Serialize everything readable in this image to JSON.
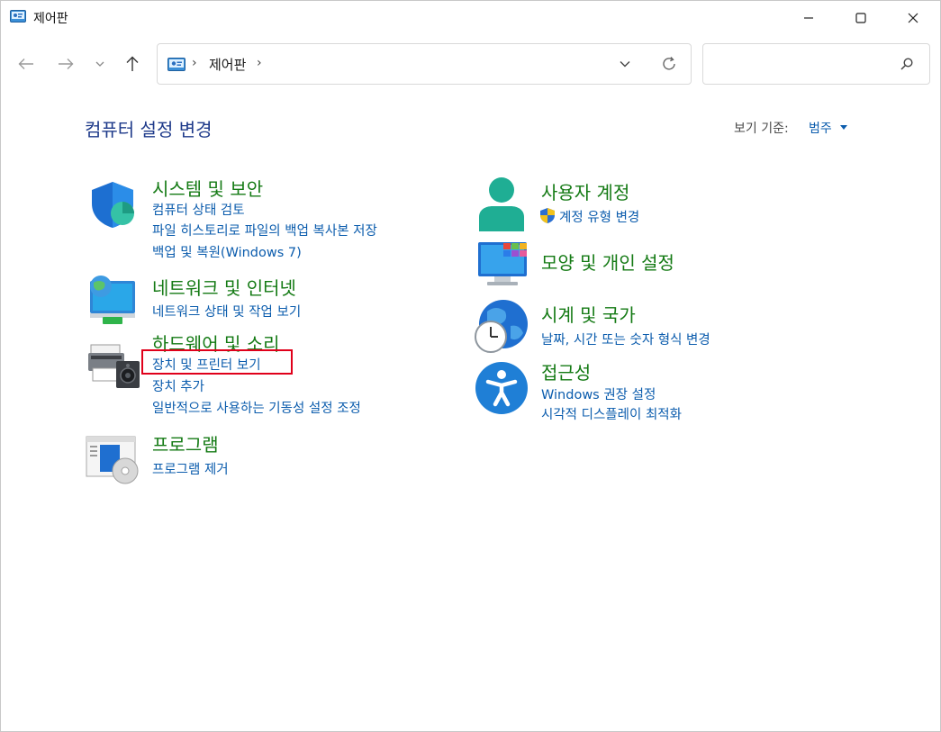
{
  "window": {
    "title": "제어판"
  },
  "address": {
    "crumb": "제어판",
    "separator": "›"
  },
  "search": {
    "placeholder": ""
  },
  "page": {
    "title": "컴퓨터 설정 변경",
    "view_by_label": "보기 기준:",
    "view_by_value": "범주"
  },
  "categories": {
    "system": {
      "title": "시스템 및 보안",
      "links": [
        "컴퓨터 상태 검토",
        "파일 히스토리로 파일의 백업 복사본 저장",
        "백업 및 복원(Windows 7)"
      ]
    },
    "network": {
      "title": "네트워크 및 인터넷",
      "links": [
        "네트워크 상태 및 작업 보기"
      ]
    },
    "hardware": {
      "title": "하드웨어 및 소리",
      "links": [
        "장치 및 프린터 보기",
        "장치 추가",
        "일반적으로 사용하는 기동성 설정 조정"
      ]
    },
    "programs": {
      "title": "프로그램",
      "links": [
        "프로그램 제거"
      ]
    },
    "users": {
      "title": "사용자 계정",
      "links": [
        "계정 유형 변경"
      ]
    },
    "appearance": {
      "title": "모양 및 개인 설정",
      "links": []
    },
    "clock": {
      "title": "시계 및 국가",
      "links": [
        "날짜, 시간 또는 숫자 형식 변경"
      ]
    },
    "access": {
      "title": "접근성",
      "links": [
        "Windows 권장 설정",
        "시각적 디스플레이 최적화"
      ]
    }
  },
  "colors": {
    "category_title": "#147a14",
    "link": "#0b5cad",
    "page_title": "#1e3a8a",
    "highlight": "#e0001a"
  },
  "icons": [
    "control-panel-icon",
    "minimize-icon",
    "maximize-icon",
    "close-icon",
    "back-arrow-icon",
    "forward-arrow-icon",
    "recent-dropdown-icon",
    "up-arrow-icon",
    "chevron-down-icon",
    "refresh-icon",
    "search-icon",
    "security-shield-icon",
    "network-globe-icon",
    "printer-speaker-icon",
    "programs-disc-icon",
    "user-icon",
    "uac-shield-icon",
    "monitor-palette-icon",
    "globe-clock-icon",
    "accessibility-icon"
  ]
}
